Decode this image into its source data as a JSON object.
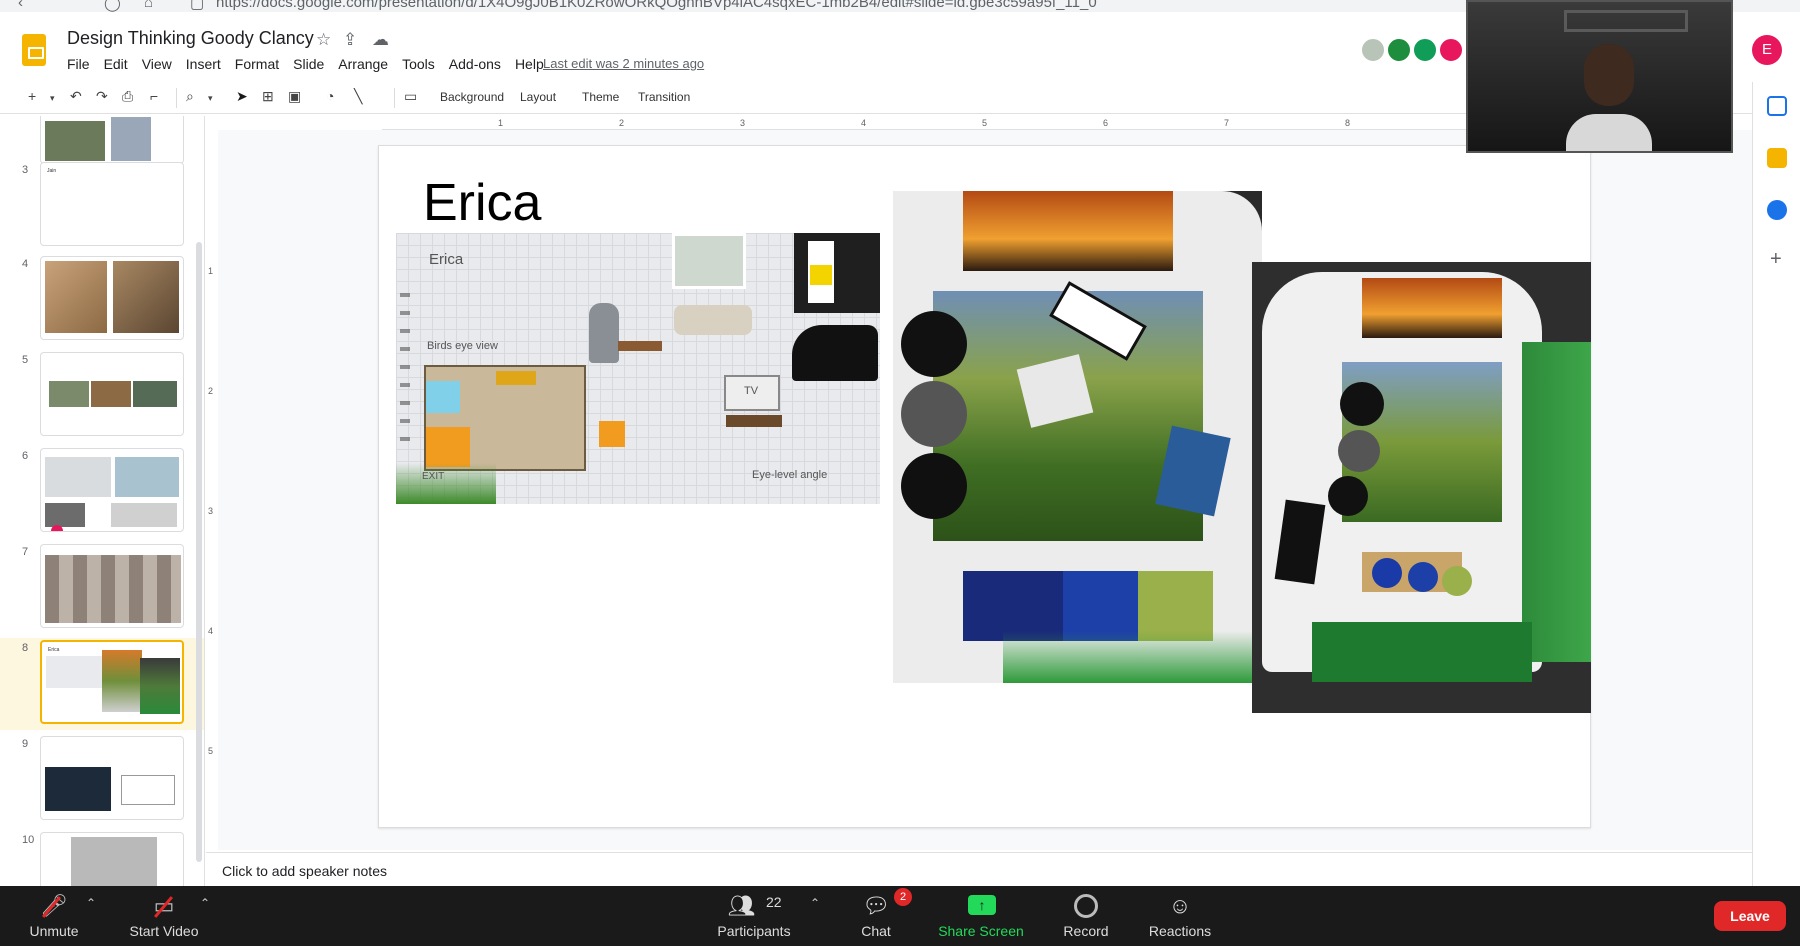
{
  "browser": {
    "url": "https://docs.google.com/presentation/d/1X4O9gJ0B1K0ZRowORkQOgnnBVp4lAC4sqxEC-1mb2B4/edit#slide=id.gbe3c59a95f_11_0"
  },
  "app": {
    "document_title": "Design Thinking Goody Clancy",
    "last_edit": "Last edit was 2 minutes ago",
    "account_initial": "E"
  },
  "menu": [
    "File",
    "Edit",
    "View",
    "Insert",
    "Format",
    "Slide",
    "Arrange",
    "Tools",
    "Add-ons",
    "Help"
  ],
  "toolbar": {
    "background": "Background",
    "layout": "Layout",
    "theme": "Theme",
    "transition": "Transition"
  },
  "filmstrip": {
    "selected_slide": 8,
    "slides": [
      {
        "number": "3"
      },
      {
        "number": "4"
      },
      {
        "number": "5"
      },
      {
        "number": "6"
      },
      {
        "number": "7"
      },
      {
        "number": "8"
      },
      {
        "number": "9"
      },
      {
        "number": "10"
      }
    ]
  },
  "ruler": {
    "marks": [
      "1",
      "2",
      "3",
      "4",
      "5",
      "6",
      "7",
      "8"
    ]
  },
  "slide": {
    "heading": "Erica",
    "moodboard": {
      "name": "Erica",
      "birds_eye": "Birds eye view",
      "tv": "TV",
      "eye_level": "Eye-level angle",
      "exit": "EXIT"
    }
  },
  "notes": {
    "placeholder": "Click to add speaker notes"
  },
  "zoom": {
    "unmute": "Unmute",
    "start_video": "Start Video",
    "participants": "Participants",
    "participants_count": "22",
    "chat": "Chat",
    "chat_badge": "2",
    "share_screen": "Share Screen",
    "record": "Record",
    "reactions": "Reactions",
    "leave": "Leave"
  },
  "colors": {
    "docs_yellow": "#f4b400",
    "share_green": "#23d959",
    "leave_red": "#e02828",
    "selected_slide_bg": "#fef7e0"
  }
}
